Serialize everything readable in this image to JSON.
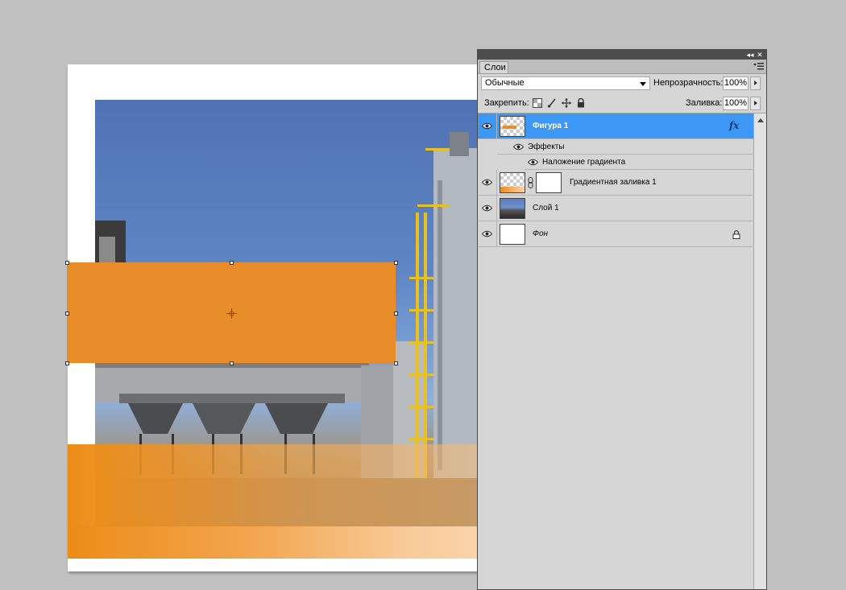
{
  "panel": {
    "title_buttons": {
      "collapse": "◂◂",
      "close": "✕"
    },
    "tab_label": "Слои",
    "blend_mode": "Обычные",
    "opacity_label": "Непрозрачность:",
    "opacity_value": "100%",
    "lock_label": "Закрепить:",
    "fill_label": "Заливка:",
    "fill_value": "100%"
  },
  "layers": [
    {
      "name": "Фигура 1",
      "selected": true,
      "fx": "fx"
    },
    {
      "name": "Эффекты",
      "sub": true
    },
    {
      "name": "Наложение градиента",
      "sub": true
    },
    {
      "name": "Градиентная заливка 1"
    },
    {
      "name": "Слой 1"
    },
    {
      "name": "Фон",
      "locked": true
    }
  ],
  "colors": {
    "shape_orange": "#e98d2b",
    "selection_blue": "#3d97f5",
    "panel_bg": "#d6d6d6",
    "workspace": "#c0c0c0"
  },
  "icons": [
    "eye-icon",
    "lock-icon",
    "fx-icon",
    "chain-link-icon",
    "panel-menu-icon",
    "move-icon",
    "brush-icon",
    "transparency-lock-icon"
  ]
}
